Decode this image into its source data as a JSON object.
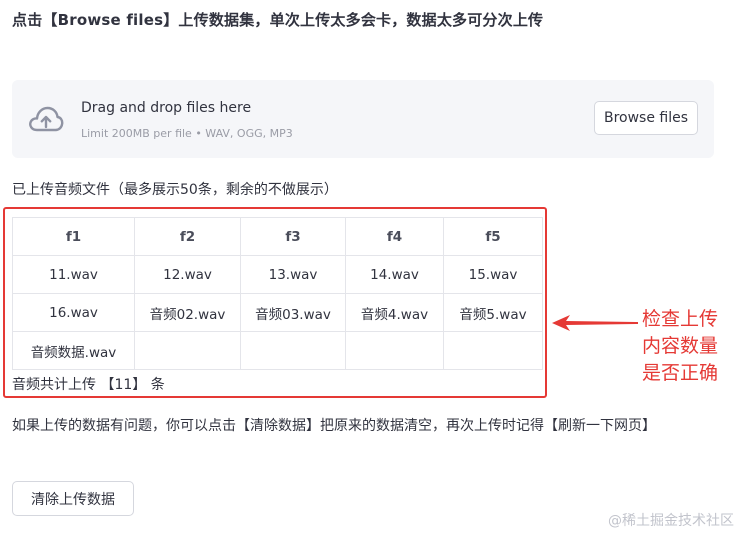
{
  "heading": "点击【Browse files】上传数据集，单次上传太多会卡，数据太多可分次上传",
  "uploader": {
    "icon": "cloud-upload-icon",
    "title": "Drag and drop files here",
    "subtitle": "Limit 200MB per file • WAV, OGG, MP3",
    "browse_label": "Browse files"
  },
  "file_list": {
    "caption": "已上传音频文件（最多展示50条，剩余的不做展示）",
    "columns": [
      "f1",
      "f2",
      "f3",
      "f4",
      "f5"
    ],
    "rows": [
      [
        "11.wav",
        "12.wav",
        "13.wav",
        "14.wav",
        "15.wav"
      ],
      [
        "16.wav",
        "音频02.wav",
        "音频03.wav",
        "音频4.wav",
        "音频5.wav"
      ],
      [
        "音频数据.wav",
        "",
        "",
        "",
        ""
      ]
    ],
    "count_text": "音频共计上传 【11】 条"
  },
  "annotation": {
    "lines": [
      "检查上传",
      "内容数量",
      "是否正确"
    ],
    "color": "#e53935"
  },
  "notice": "如果上传的数据有问题，你可以点击【清除数据】把原来的数据清空，再次上传时记得【刷新一下网页】",
  "clear_button_label": "清除上传数据",
  "watermark": "@稀土掘金技术社区"
}
